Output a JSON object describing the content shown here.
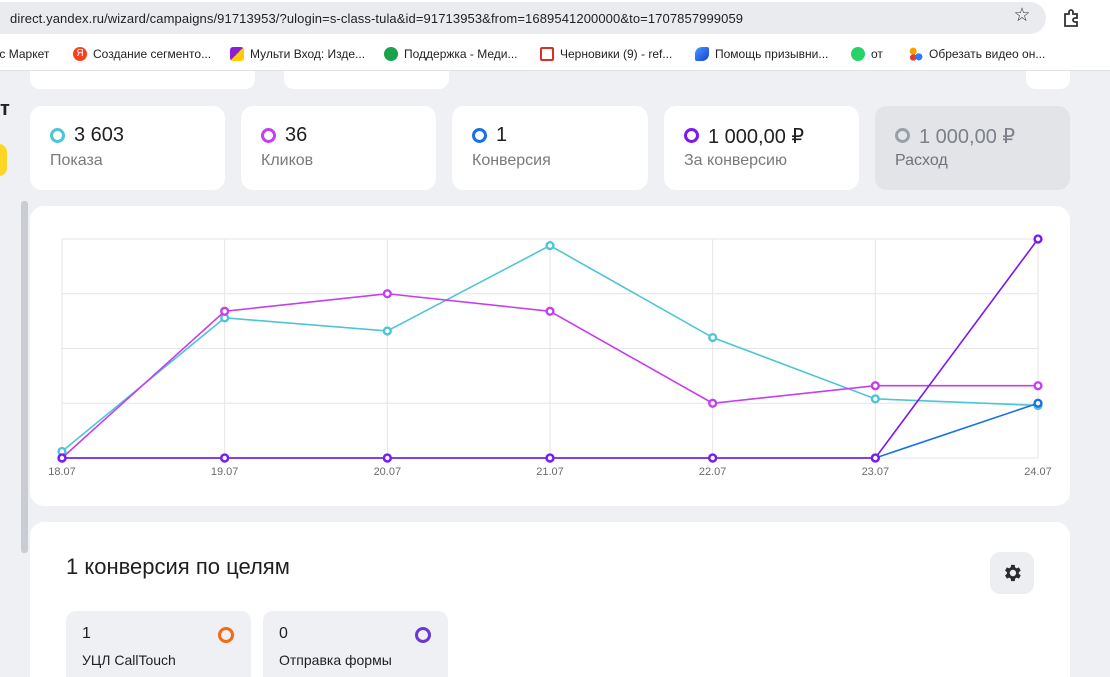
{
  "browser": {
    "url": "direct.yandex.ru/wizard/campaigns/91713953/?ulogin=s-class-tula&id=91713953&from=1689541200000&to=1707857999059",
    "bookmarks": [
      {
        "label": "кс Маркет",
        "icon": "market-icon",
        "color": ""
      },
      {
        "label": "Создание сегменто...",
        "icon": "yandex-icon",
        "color": "#fc3f1d"
      },
      {
        "label": "Мульти Вход: Изде...",
        "icon": "multi-icon",
        "color": "#8b1fd6"
      },
      {
        "label": "Поддержка - Меди...",
        "icon": "microphone-icon",
        "color": "#1aa34a"
      },
      {
        "label": "Черновики (9) - ref...",
        "icon": "gmail-icon",
        "color": "#d93025"
      },
      {
        "label": "Помощь призывни...",
        "icon": "feather-icon",
        "color": "#1a3bd6"
      },
      {
        "label": "от",
        "icon": "whatsapp-icon",
        "color": "#25d366"
      },
      {
        "label": "Обрезать видео он...",
        "icon": "dots-icon",
        "color": "#f4a300"
      }
    ]
  },
  "sidebar": {
    "letter": "т"
  },
  "metrics": [
    {
      "value": "3 603",
      "label": "Показа",
      "color": "#4ec5d4"
    },
    {
      "value": "36",
      "label": "Кликов",
      "color": "#c53ff0"
    },
    {
      "value": "1",
      "label": "Конверсия",
      "color": "#1671e6"
    },
    {
      "value": "1 000,00 ₽",
      "label": "За конверсию",
      "color": "#7c19f0"
    },
    {
      "value": "1 000,00 ₽",
      "label": "Расход",
      "color": "#9aa0a8"
    }
  ],
  "chart_data": {
    "type": "line",
    "categories": [
      "18.07",
      "19.07",
      "20.07",
      "21.07",
      "22.07",
      "23.07",
      "24.07"
    ],
    "grid": true,
    "yticks_shown": false,
    "series": [
      {
        "color": "#4ec5d4",
        "values": [
          0.03,
          0.64,
          0.58,
          0.97,
          0.55,
          0.27,
          0.24
        ]
      },
      {
        "color": "#c53ff0",
        "values": [
          0,
          0.67,
          0.75,
          0.67,
          0.25,
          0.33,
          0.33
        ]
      },
      {
        "color": "#1671e6",
        "values": [
          0,
          0,
          0,
          0,
          0,
          0,
          0.25
        ]
      },
      {
        "color": "#7c19f0",
        "values": [
          0,
          0,
          0,
          0,
          0,
          0,
          1
        ]
      }
    ]
  },
  "conversions": {
    "title": "1 конверсия по целям",
    "goals": [
      {
        "count": "1",
        "name": "УЦЛ CallTouch",
        "color": "#f36b12"
      },
      {
        "count": "0",
        "name": "Отправка формы",
        "color": "#6a38d1"
      }
    ]
  }
}
